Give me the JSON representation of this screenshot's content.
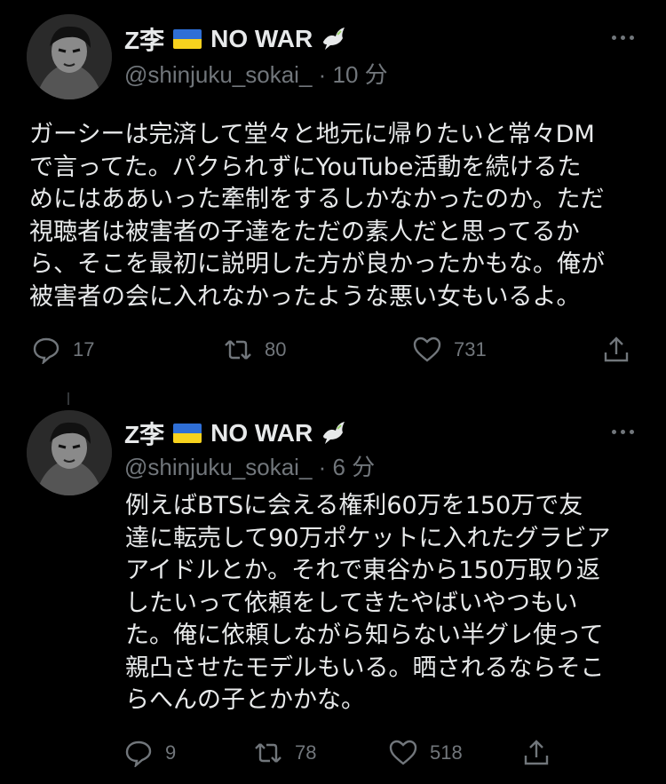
{
  "tweets": [
    {
      "author_name": "Z李",
      "author_suffix": "NO WAR",
      "handle": "@shinjuku_sokai_",
      "time": "· 10 分",
      "lines": [
        "ガーシーは完済して堂々と地元に帰りたいと常々DM",
        "で言ってた。パクられずにYouTube活動を続けるた",
        "めにはああいった牽制をするしかなかったのか。ただ",
        "視聴者は被害者の子達をただの素人だと思ってるか",
        "ら、そこを最初に説明した方が良かったかもな。俺が",
        "被害者の会に入れなかったような悪い女もいるよ。"
      ],
      "replies": "17",
      "retweets": "80",
      "likes": "731"
    },
    {
      "author_name": "Z李",
      "author_suffix": "NO WAR",
      "handle": "@shinjuku_sokai_",
      "time": "· 6 分",
      "lines": [
        "例えばBTSに会える権利60万を150万で友",
        "達に転売して90万ポケットに入れたグラビア",
        "アイドルとか。それで東谷から150万取り返",
        "したいって依頼をしてきたやばいやつもい",
        "た。俺に依頼しながら知らない半グレ使って",
        "親凸させたモデルもいる。晒されるならそこ",
        "らへんの子とかかな。"
      ],
      "replies": "9",
      "retweets": "78",
      "likes": "518"
    }
  ],
  "icons": {
    "reply": "reply-icon",
    "retweet": "retweet-icon",
    "like": "heart-icon",
    "share": "share-icon",
    "more": "more-icon",
    "flag": "ukraine-flag-icon",
    "dove": "dove-icon"
  },
  "colors": {
    "background": "#000000",
    "text": "#e7e9ea",
    "secondary": "#71767b",
    "flag_blue": "#2f6fd6",
    "flag_yellow": "#f7d21e"
  }
}
